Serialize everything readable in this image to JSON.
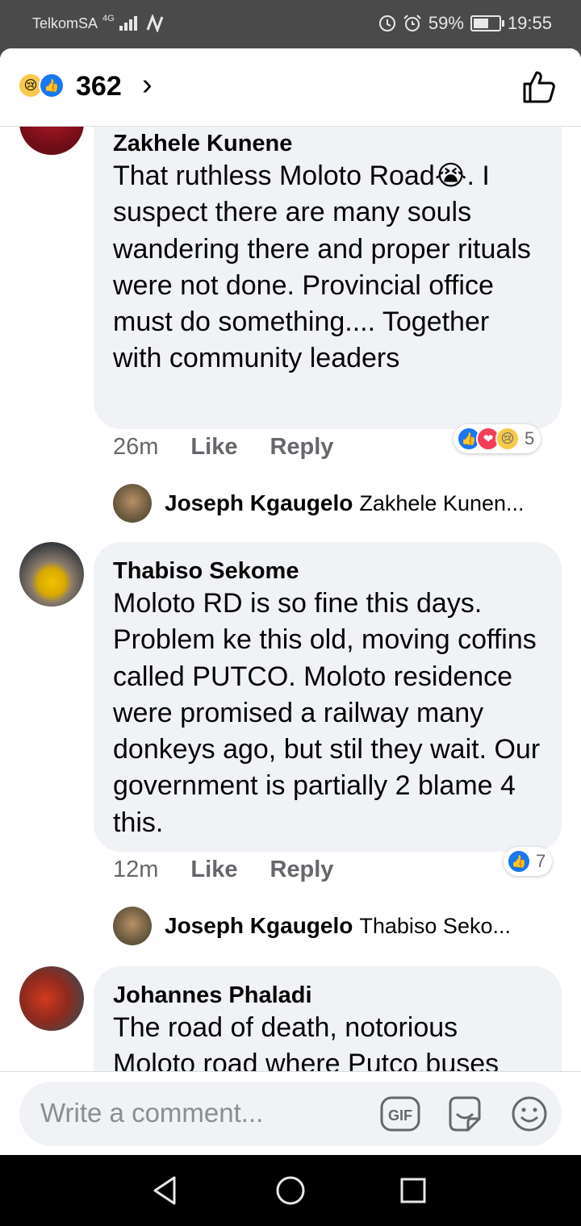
{
  "status_bar": {
    "carrier": "TelkomSA",
    "network": "4G",
    "battery": "59%",
    "battery_level": 0.59,
    "time": "19:55"
  },
  "header": {
    "reaction_icons": [
      "sad-reaction",
      "like-reaction"
    ],
    "reaction_count": "362"
  },
  "comments": [
    {
      "author": "Zakhele Kunene",
      "text": "That ruthless Moloto Road😭. I suspect there are many souls wandering there and proper rituals were not done. Provincial office must do something.... Together with community leaders",
      "time": "26m",
      "like_label": "Like",
      "reply_label": "Reply",
      "reactions": [
        "like",
        "love",
        "sad"
      ],
      "reaction_count": "5",
      "reply": {
        "author": "Joseph Kgaugelo",
        "snippet": "Zakhele Kunen..."
      }
    },
    {
      "author": "Thabiso Sekome",
      "text": "Moloto RD is so fine this days. Problem ke this old, moving coffins called PUTCO. Moloto residence were promised a railway many donkeys ago, but stil they wait. Our government is partially 2 blame 4 this.",
      "time": "12m",
      "like_label": "Like",
      "reply_label": "Reply",
      "reactions": [
        "like"
      ],
      "reaction_count": "7",
      "reply": {
        "author": "Joseph Kgaugelo",
        "snippet": "Thabiso Seko..."
      }
    },
    {
      "author": "Johannes Phaladi",
      "text": "The road of death, notorious Moloto road where Putco buses"
    }
  ],
  "composer": {
    "placeholder": "Write a comment...",
    "icons": [
      "gif-icon",
      "sticker-icon",
      "emoji-icon"
    ]
  },
  "colors": {
    "facebook_blue": "#1877f2",
    "bubble": "#f0f2f5",
    "meta_text": "#65676b"
  }
}
